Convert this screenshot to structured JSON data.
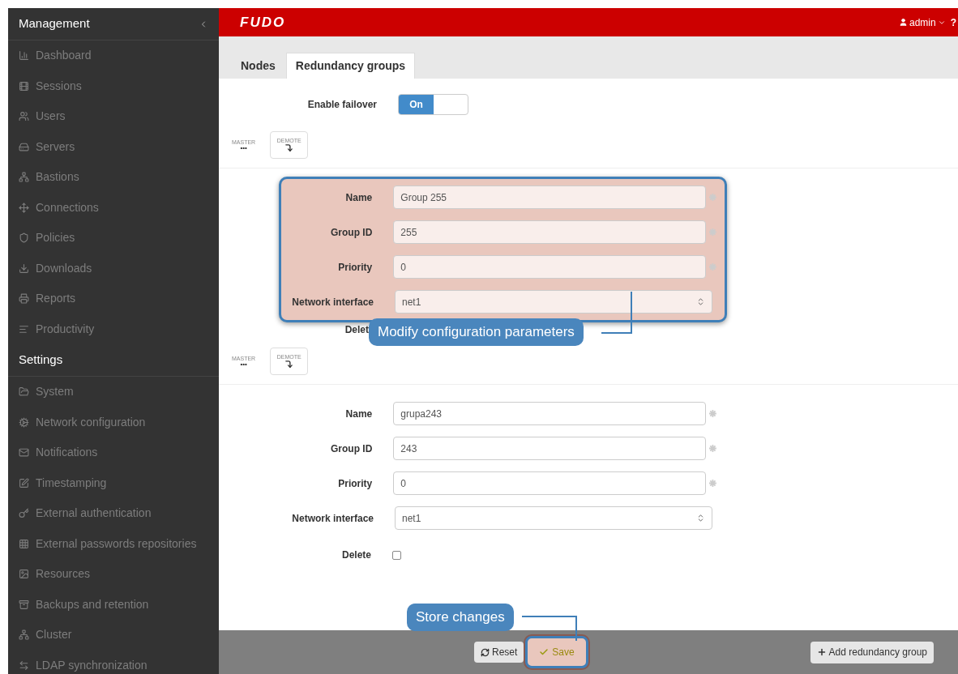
{
  "sidebar": {
    "sections": [
      {
        "title": "Management",
        "collapsible": true,
        "items": [
          {
            "label": "Dashboard"
          },
          {
            "label": "Sessions"
          },
          {
            "label": "Users"
          },
          {
            "label": "Servers"
          },
          {
            "label": "Bastions"
          },
          {
            "label": "Connections"
          },
          {
            "label": "Policies"
          },
          {
            "label": "Downloads"
          },
          {
            "label": "Reports"
          },
          {
            "label": "Productivity"
          }
        ]
      },
      {
        "title": "Settings",
        "collapsible": false,
        "items": [
          {
            "label": "System"
          },
          {
            "label": "Network configuration"
          },
          {
            "label": "Notifications"
          },
          {
            "label": "Timestamping"
          },
          {
            "label": "External authentication"
          },
          {
            "label": "External passwords repositories"
          },
          {
            "label": "Resources"
          },
          {
            "label": "Backups and retention"
          },
          {
            "label": "Cluster"
          },
          {
            "label": "LDAP synchronization"
          }
        ]
      }
    ]
  },
  "topbar": {
    "logo": "FUDO",
    "user": "admin",
    "help": "?"
  },
  "tabs": [
    {
      "label": "Nodes",
      "selected": false
    },
    {
      "label": "Redundancy groups",
      "selected": true
    }
  ],
  "failover": {
    "label": "Enable failover",
    "toggle_text": "On",
    "on": true
  },
  "groups": [
    {
      "master_label": "MASTER",
      "master_value": "•••",
      "demote_label": "DEMOTE",
      "highlighted": true,
      "fields": [
        {
          "label": "Name",
          "value": "Group 255",
          "kind": "text"
        },
        {
          "label": "Group ID",
          "value": "255",
          "kind": "text"
        },
        {
          "label": "Priority",
          "value": "0",
          "kind": "text"
        },
        {
          "label": "Network interface",
          "value": "net1",
          "kind": "select"
        }
      ],
      "delete_label": "Delet"
    },
    {
      "master_label": "MASTER",
      "master_value": "•••",
      "demote_label": "DEMOTE",
      "highlighted": false,
      "fields": [
        {
          "label": "Name",
          "value": "grupa243",
          "kind": "text"
        },
        {
          "label": "Group ID",
          "value": "243",
          "kind": "text"
        },
        {
          "label": "Priority",
          "value": "0",
          "kind": "text"
        },
        {
          "label": "Network interface",
          "value": "net1",
          "kind": "select"
        }
      ],
      "delete_label": "Delete",
      "delete_checked": false
    }
  ],
  "footer": {
    "reset": "Reset",
    "save": "Save",
    "save_highlighted": true,
    "add": "Add redundancy group"
  },
  "callouts": [
    {
      "text": "Modify configuration parameters"
    },
    {
      "text": "Store changes"
    }
  ]
}
